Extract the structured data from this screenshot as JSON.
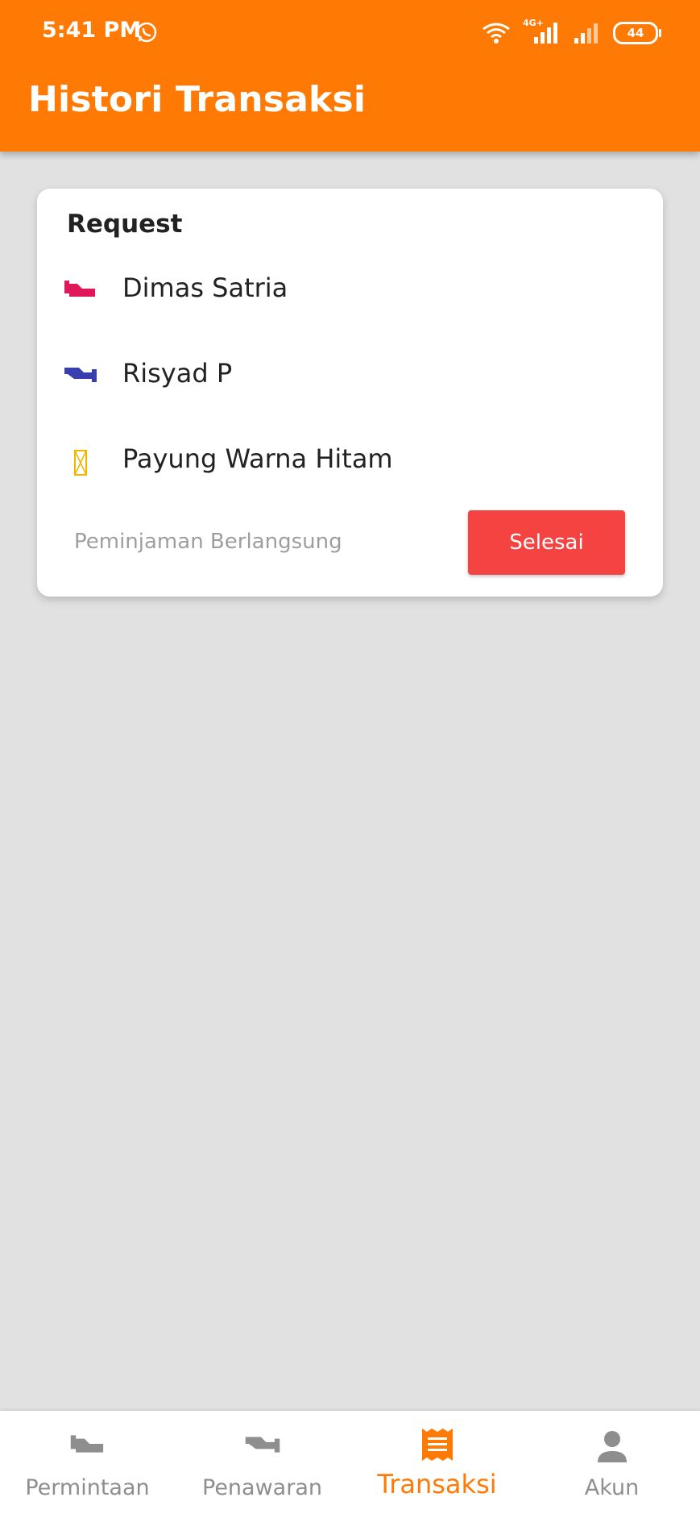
{
  "status_bar": {
    "time": "5:41 PM",
    "network": "4G+",
    "battery": "44",
    "icons": [
      "whatsapp-icon",
      "wifi-icon",
      "signal-icon",
      "signal-icon",
      "battery-icon"
    ]
  },
  "header": {
    "title": "Histori Transaksi"
  },
  "colors": {
    "accent": "#ff7a05",
    "danger": "#f44340",
    "requester_icon": "#e0185a",
    "offerer_icon": "#3a3fb0",
    "item_icon": "#f2b600"
  },
  "card": {
    "label": "Request",
    "rows": [
      {
        "icon": "hand-receive-icon",
        "text": "Dimas Satria"
      },
      {
        "icon": "hand-give-icon",
        "text": "Risyad P"
      },
      {
        "icon": "item-placeholder-icon",
        "text": "Payung Warna Hitam"
      }
    ],
    "status_text": "Peminjaman Berlangsung",
    "button_label": "Selesai"
  },
  "bottom_nav": {
    "items": [
      {
        "label": "Permintaan",
        "icon": "hand-receive-icon",
        "active": false
      },
      {
        "label": "Penawaran",
        "icon": "hand-give-icon",
        "active": false
      },
      {
        "label": "Transaksi",
        "icon": "receipt-icon",
        "active": true
      },
      {
        "label": "Akun",
        "icon": "person-icon",
        "active": false
      }
    ]
  }
}
